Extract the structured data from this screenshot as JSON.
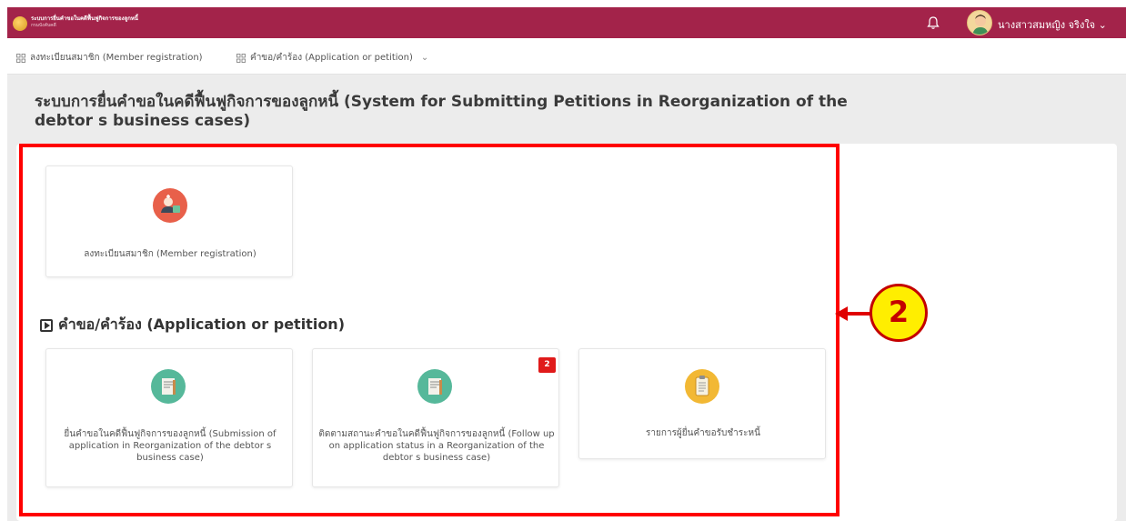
{
  "header": {
    "system_title": "ระบบการยื่นคำขอในคดีฟื้นฟูกิจการของลูกหนี้",
    "department": "กรมบังคับคดี",
    "user_name": "นางสาวสมหญิง จริงใจ",
    "user_chevron": "⌄",
    "accent_color": "#a3234a"
  },
  "menu": {
    "items": [
      {
        "label": "ลงทะเบียนสมาชิก (Member registration)"
      },
      {
        "label": "คำขอ/คำร้อง (Application or petition)",
        "chevron": "⌄"
      }
    ]
  },
  "page": {
    "title": "ระบบการยื่นคำขอในคดีฟื้นฟูกิจการของลูกหนี้ (System for Submitting Petitions in Reorganization of the debtor s business cases)"
  },
  "registration_card": {
    "label": "ลงทะเบียนสมาชิก (Member registration)",
    "icon": "member-registration-icon"
  },
  "application_section": {
    "title": "คำขอ/คำร้อง (Application or petition)",
    "cards": [
      {
        "label": "ยื่นคำขอในคดีฟื้นฟูกิจการของลูกหนี้ (Submission of application in Reorganization of the debtor s business case)",
        "icon": "document-icon"
      },
      {
        "label": "ติดตามสถานะคำขอในคดีฟื้นฟูกิจการของลูกหนี้ (Follow up on application status in a Reorganization of the debtor s business case)",
        "icon": "document-icon",
        "badge": "2"
      },
      {
        "label": "รายการผู้ยื่นคำขอรับชำระหนี้",
        "icon": "clipboard-icon"
      }
    ]
  },
  "annotation": {
    "callout_number": "2",
    "color": "#ff0000"
  }
}
